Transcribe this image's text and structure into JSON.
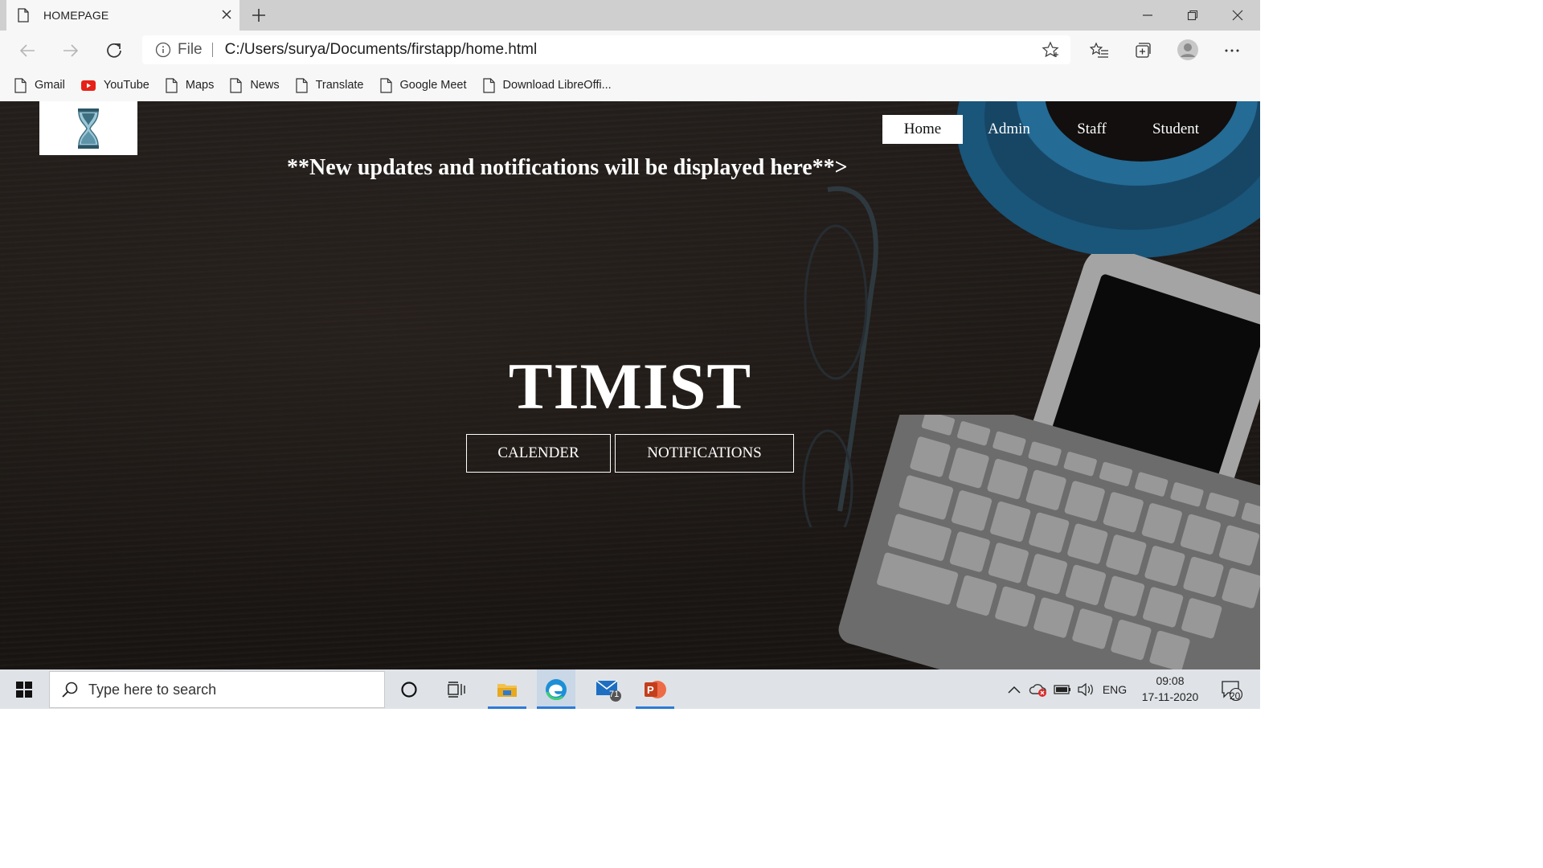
{
  "browser": {
    "tab_title": "HOMEPAGE",
    "address": {
      "scheme_label": "File",
      "url": "C:/Users/surya/Documents/firstapp/home.html"
    },
    "bookmarks": [
      {
        "label": "Gmail",
        "icon": "page-icon"
      },
      {
        "label": "YouTube",
        "icon": "youtube-icon"
      },
      {
        "label": "Maps",
        "icon": "page-icon"
      },
      {
        "label": "News",
        "icon": "page-icon"
      },
      {
        "label": "Translate",
        "icon": "page-icon"
      },
      {
        "label": "Google Meet",
        "icon": "page-icon"
      },
      {
        "label": "Download LibreOffi...",
        "icon": "page-icon"
      }
    ]
  },
  "site": {
    "nav": [
      {
        "label": "Home",
        "active": true
      },
      {
        "label": "Admin",
        "active": false
      },
      {
        "label": "Staff",
        "active": false
      },
      {
        "label": "Student",
        "active": false
      }
    ],
    "notice": "**New updates and notifications will be displayed here**>",
    "title": "TIMIST",
    "buttons": {
      "calendar": "CALENDER",
      "notifications": "NOTIFICATIONS"
    }
  },
  "taskbar": {
    "search_placeholder": "Type here to search",
    "mail_badge": "71",
    "language": "ENG",
    "time": "09:08",
    "date": "17-11-2020",
    "notification_count": "20"
  },
  "colors": {
    "taskbar_bg": "#dfe3e7",
    "accent_underline": "#2d7ad6",
    "page_bg": "#241f1b"
  }
}
